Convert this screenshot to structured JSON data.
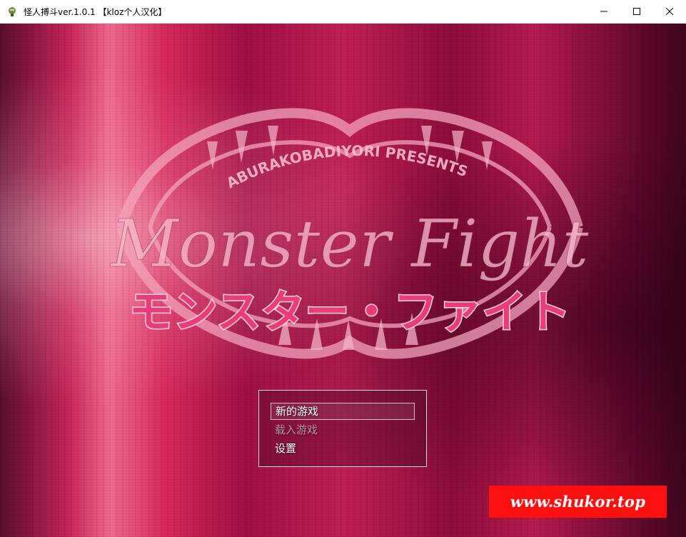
{
  "window": {
    "title": "怪人搏斗ver.1.0.1 【kloz个人汉化】",
    "icon": "game-app-icon",
    "controls": {
      "minimize_icon": "minimize-icon",
      "maximize_icon": "maximize-icon",
      "close_icon": "close-icon"
    }
  },
  "title_screen": {
    "logo": {
      "presenter": "ABURAKOBADIYORI PRESENTS",
      "title_en": "Monster Fight",
      "title_jp": "モンスター・ファイト"
    },
    "menu": {
      "items": [
        {
          "label": "新的游戏",
          "state": "selected"
        },
        {
          "label": "载入游戏",
          "state": "disabled"
        },
        {
          "label": "设置",
          "state": "enabled"
        }
      ]
    }
  },
  "watermark": {
    "text": "www.shukor.top"
  },
  "colors": {
    "background_primary": "#c2245a",
    "background_dark": "#3e061c",
    "logo_main": "#f4a6bf",
    "logo_jp": "#e83d78",
    "watermark_bg": "#ff1010"
  }
}
